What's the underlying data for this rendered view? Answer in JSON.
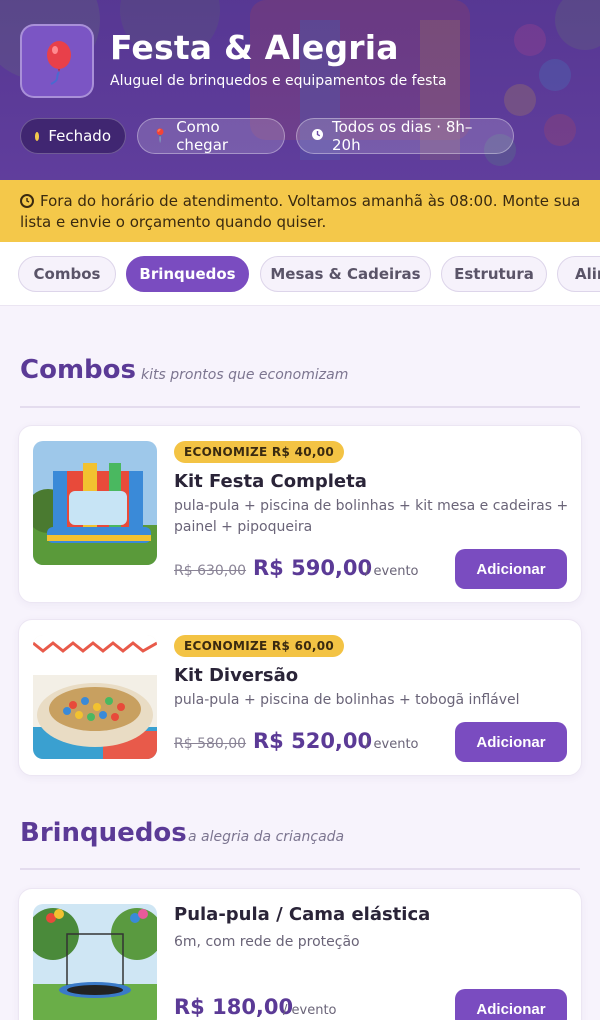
{
  "header": {
    "title": "Festa & Alegria",
    "subtitle": "Aluguel de brinquedos e equipamentos de festa",
    "logo_icon": "balloon-icon",
    "chips": {
      "status": "Fechado",
      "directions": "Como chegar",
      "hours": "Todos os dias · 8h–20h"
    },
    "colors": {
      "brand": "#7a4cc0",
      "status_dot": "#f2c94c"
    }
  },
  "banner": {
    "icon": "clock-icon",
    "text": "Fora do horário de atendimento. Voltamos amanhã às 08:00. Monte sua lista e envie o orçamento quando quiser.",
    "color": "#f4c84a"
  },
  "tabs": [
    {
      "label": "Combos",
      "active": false
    },
    {
      "label": "Brinquedos",
      "active": true
    },
    {
      "label": "Mesas & Cadeiras",
      "active": false
    },
    {
      "label": "Estrutura",
      "active": false
    },
    {
      "label": "Alim",
      "active": false
    }
  ],
  "sections": {
    "combos": {
      "title": "Combos",
      "subtitle": "kits prontos que economizam",
      "items": [
        {
          "badge": "ECONOMIZE R$ 40,00",
          "name": "Kit Festa Completa",
          "description": "pula-pula + piscina de bolinhas + kit mesa e cadeiras + painel + pipoqueira",
          "old_price": "R$ 630,00",
          "price": "R$ 590,00",
          "unit": "/ evento",
          "button": "Adicionar"
        },
        {
          "badge": "ECONOMIZE R$ 60,00",
          "name": "Kit Diversão",
          "description": "pula-pula + piscina de bolinhas + tobogã inflável",
          "old_price": "R$ 580,00",
          "price": "R$ 520,00",
          "unit": "/ evento",
          "button": "Adicionar"
        }
      ]
    },
    "brinquedos": {
      "title": "Brinquedos",
      "subtitle": "a alegria da criançada",
      "items": [
        {
          "name": "Pula-pula / Cama elástica",
          "description": "6m, com rede de proteção",
          "price": "R$ 180,00",
          "unit": "/ evento",
          "button": "Adicionar"
        }
      ]
    }
  }
}
